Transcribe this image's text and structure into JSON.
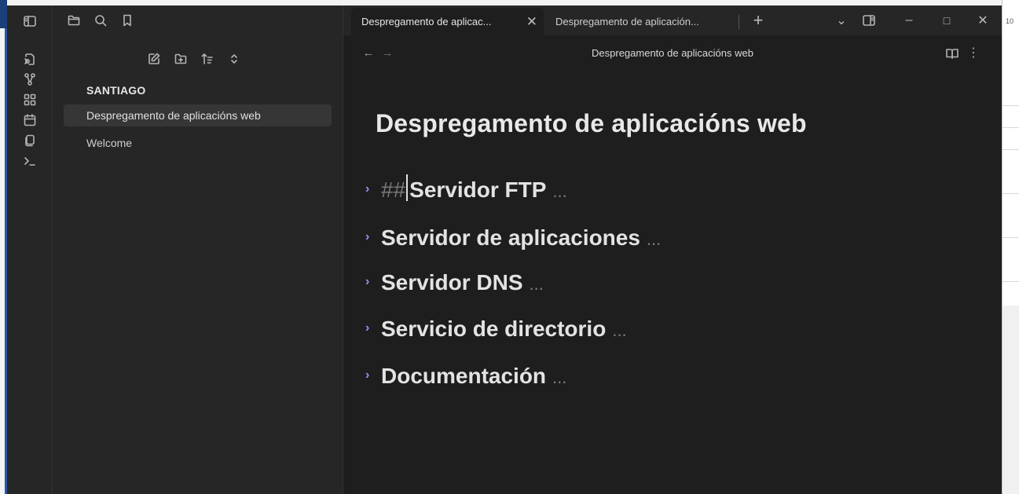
{
  "ribbon": {
    "icons": [
      "sidebar-toggle-icon",
      "open-quick-switcher-icon",
      "graph-view-icon",
      "canvas-icon",
      "daily-note-icon",
      "templates-icon",
      "command-palette-icon"
    ]
  },
  "sidebar": {
    "tab_icons": [
      "folder-icon",
      "search-icon",
      "bookmark-icon"
    ],
    "toolbar_icons": [
      "new-note-icon",
      "new-folder-icon",
      "sort-icon",
      "collapse-icon"
    ],
    "vault_name": "SANTIAGO",
    "files": [
      {
        "label": "Despregamento de aplicacións web",
        "active": true
      },
      {
        "label": "Welcome",
        "active": false
      }
    ]
  },
  "tabs": [
    {
      "label": "Despregamento de aplicac...",
      "active": true,
      "close": "✕"
    },
    {
      "label": "Despregamento de aplicación...",
      "active": false
    }
  ],
  "tabbar": {
    "new_tab": "+",
    "dropdown": "⌄",
    "minimize": "–",
    "maximize": "□",
    "close": "✕"
  },
  "view_header": {
    "back": "←",
    "forward": "→",
    "title": "Despregamento de aplicacións web",
    "more": "⋮"
  },
  "document": {
    "title": "Despregamento de aplicacións web",
    "headings": [
      {
        "hash": "##",
        "text": "Servidor FTP",
        "ellipsis": "...",
        "editing": true
      },
      {
        "text": "Servidor de aplicaciones",
        "ellipsis": "..."
      },
      {
        "text": "Servidor DNS",
        "ellipsis": "..."
      },
      {
        "text": "Servicio de directorio",
        "ellipsis": "..."
      },
      {
        "text": "Documentación",
        "ellipsis": "..."
      }
    ]
  },
  "right_window": {
    "label": "10"
  },
  "colors": {
    "accent": "#a88bfa",
    "background": "#1e1e1e",
    "sidebar": "#262626"
  }
}
